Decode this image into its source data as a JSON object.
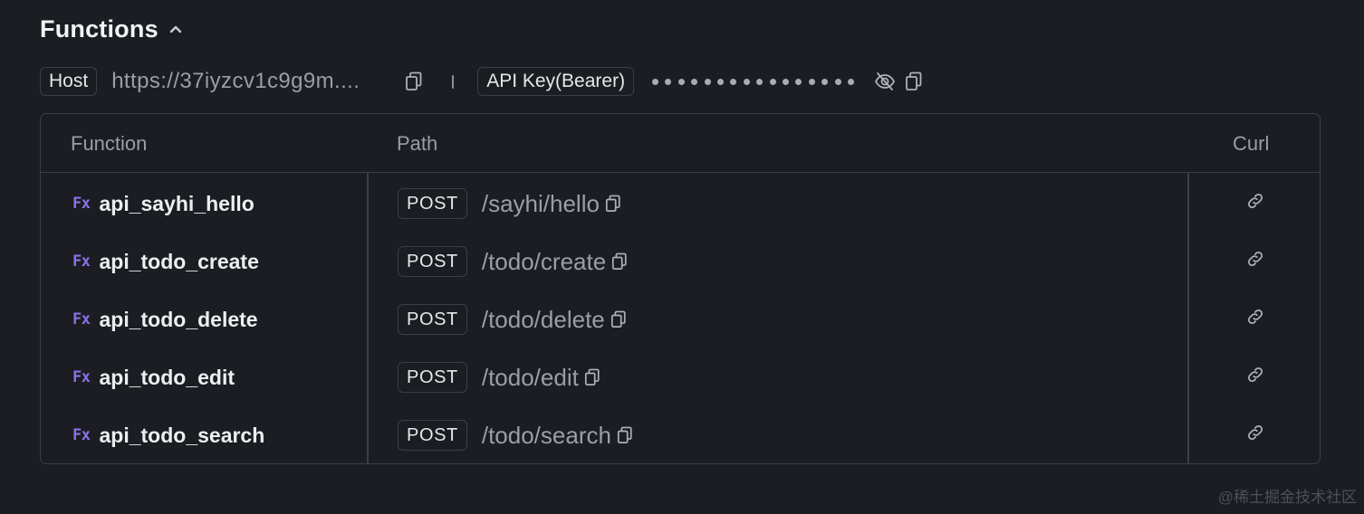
{
  "section": {
    "title": "Functions",
    "toggle_icon": "chevron-up-icon"
  },
  "info": {
    "host_label": "Host",
    "host_url": "https://37iyzcv1c9g9m....",
    "api_key_label": "API Key(Bearer)",
    "api_key_masked": "••••••••••••••••",
    "icons": [
      "copy-icon",
      "eye-off-icon",
      "copy-icon"
    ]
  },
  "table": {
    "columns": {
      "function": "Function",
      "path": "Path",
      "curl": "Curl"
    },
    "rows": [
      {
        "badge": "Fx",
        "name": "api_sayhi_hello",
        "method": "POST",
        "path": "/sayhi/hello"
      },
      {
        "badge": "Fx",
        "name": "api_todo_create",
        "method": "POST",
        "path": "/todo/create"
      },
      {
        "badge": "Fx",
        "name": "api_todo_delete",
        "method": "POST",
        "path": "/todo/delete"
      },
      {
        "badge": "Fx",
        "name": "api_todo_edit",
        "method": "POST",
        "path": "/todo/edit"
      },
      {
        "badge": "Fx",
        "name": "api_todo_search",
        "method": "POST",
        "path": "/todo/search"
      }
    ]
  },
  "watermark": "@稀土掘金技术社区",
  "colors": {
    "background": "#1b1d22",
    "border": "#3a3e46",
    "muted_text": "#9a9ea6",
    "fx_accent": "#8a72e8"
  }
}
